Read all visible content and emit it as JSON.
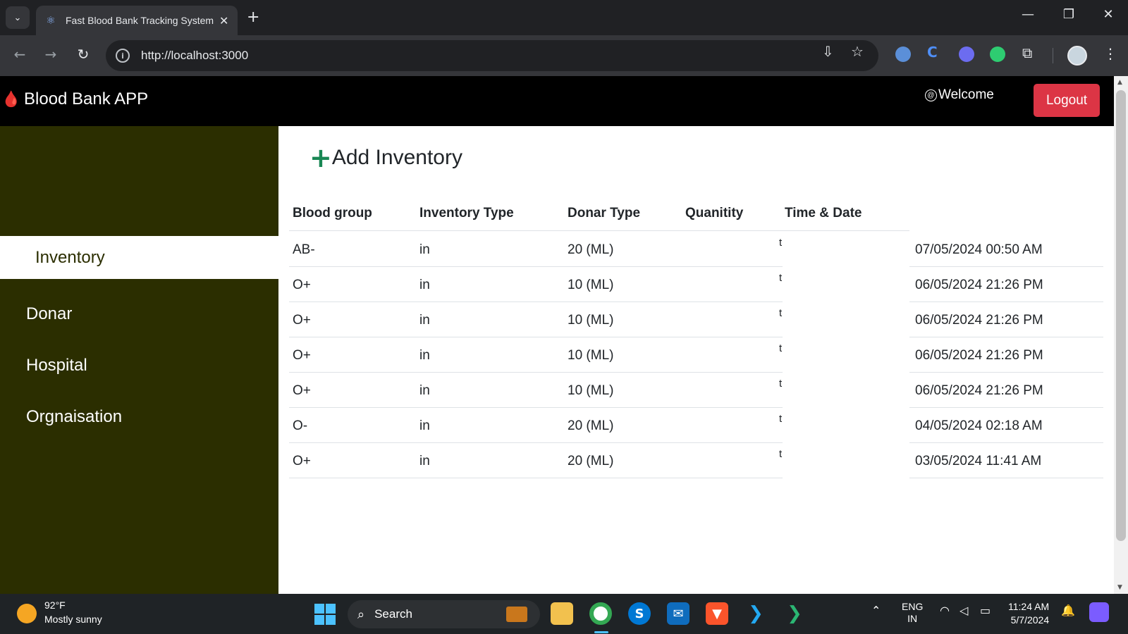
{
  "browser": {
    "tab_title": "Fast Blood Bank Tracking System",
    "url": "http://localhost:3000"
  },
  "app": {
    "brand": "Blood Bank APP",
    "welcome": "Welcome",
    "logout_label": "Logout",
    "accent_color": "#dc3545",
    "sidebar_color": "#2b2e00"
  },
  "sidebar": {
    "items": [
      {
        "label": "Inventory",
        "active": true
      },
      {
        "label": "Donar",
        "active": false
      },
      {
        "label": "Hospital",
        "active": false
      },
      {
        "label": "Orgnaisation",
        "active": false
      }
    ]
  },
  "main": {
    "add_label": "Add Inventory",
    "columns": [
      "Blood group",
      "Inventory Type",
      "Donar Type",
      "Quanitity",
      "Time & Date"
    ],
    "rows": [
      {
        "blood_group": "AB-",
        "inventory_type": "in",
        "quantity": "20 (ML)",
        "marker": "t",
        "time": "07/05/2024 00:50 AM"
      },
      {
        "blood_group": "O+",
        "inventory_type": "in",
        "quantity": "10 (ML)",
        "marker": "t",
        "time": "06/05/2024 21:26 PM"
      },
      {
        "blood_group": "O+",
        "inventory_type": "in",
        "quantity": "10 (ML)",
        "marker": "t",
        "time": "06/05/2024 21:26 PM"
      },
      {
        "blood_group": "O+",
        "inventory_type": "in",
        "quantity": "10 (ML)",
        "marker": "t",
        "time": "06/05/2024 21:26 PM"
      },
      {
        "blood_group": "O+",
        "inventory_type": "in",
        "quantity": "10 (ML)",
        "marker": "t",
        "time": "06/05/2024 21:26 PM"
      },
      {
        "blood_group": "O-",
        "inventory_type": "in",
        "quantity": "20 (ML)",
        "marker": "t",
        "time": "04/05/2024 02:18 AM"
      },
      {
        "blood_group": "O+",
        "inventory_type": "in",
        "quantity": "20 (ML)",
        "marker": "t",
        "time": "03/05/2024 11:41 AM"
      }
    ]
  },
  "taskbar": {
    "weather_temp": "92°F",
    "weather_desc": "Mostly sunny",
    "search_label": "Search",
    "lang_1": "ENG",
    "lang_2": "IN",
    "time": "11:24 AM",
    "date": "5/7/2024"
  }
}
